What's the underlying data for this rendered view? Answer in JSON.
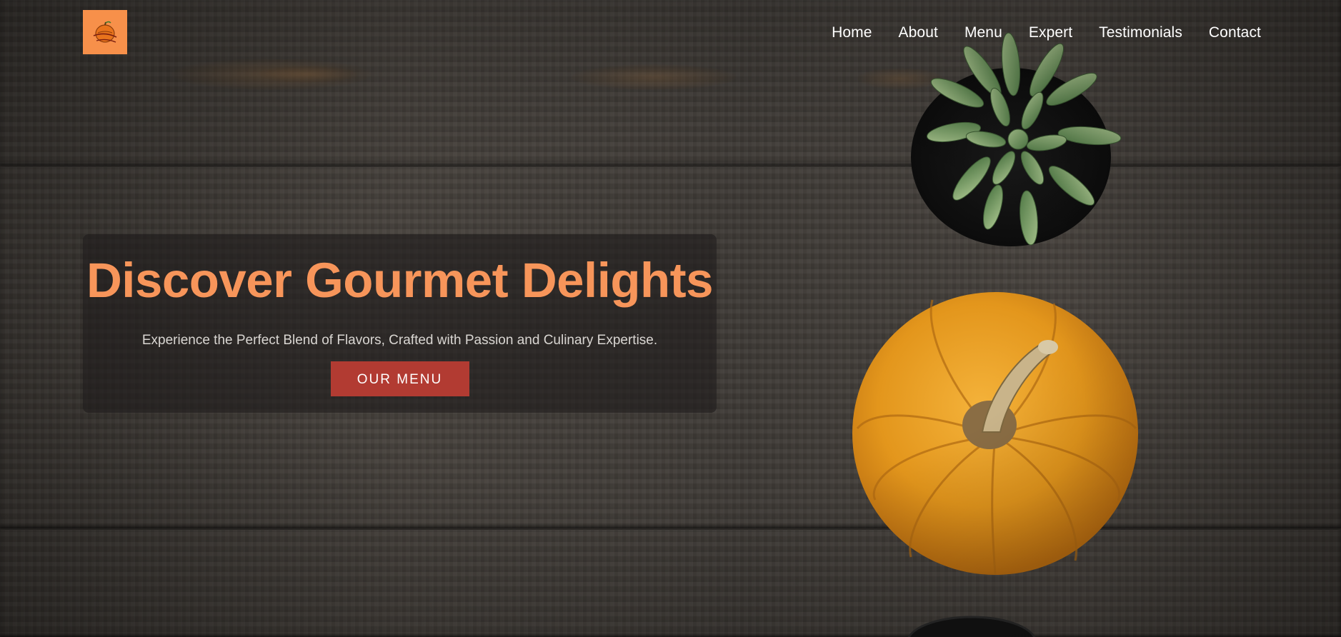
{
  "nav": {
    "items": [
      {
        "label": "Home"
      },
      {
        "label": "About"
      },
      {
        "label": "Menu"
      },
      {
        "label": "Expert"
      },
      {
        "label": "Testimonials"
      },
      {
        "label": "Contact"
      }
    ]
  },
  "hero": {
    "title": "Discover Gourmet Delights",
    "subtitle": "Experience the Perfect Blend of Flavors, Crafted with Passion and Culinary Expertise.",
    "button_label": "OUR MENU"
  },
  "colors": {
    "accent": "#f7955a",
    "button": "#b23b32",
    "logo_bg": "#f7904a"
  }
}
